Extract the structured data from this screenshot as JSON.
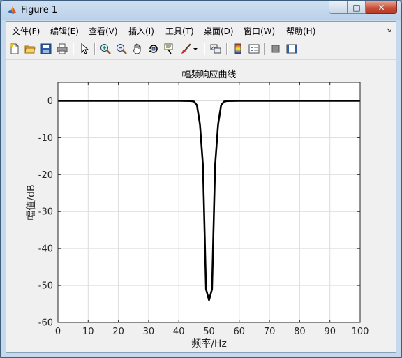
{
  "window": {
    "title": "Figure 1",
    "minimize_glyph": "–",
    "maximize_glyph": "□",
    "close_glyph": "✕"
  },
  "menu": [
    {
      "label": "文件(F)"
    },
    {
      "label": "编辑(E)"
    },
    {
      "label": "查看(V)"
    },
    {
      "label": "插入(I)"
    },
    {
      "label": "工具(T)"
    },
    {
      "label": "桌面(D)"
    },
    {
      "label": "窗口(W)"
    },
    {
      "label": "帮助(H)"
    }
  ],
  "menu_dock_glyph": "↘",
  "toolbar": [
    {
      "icon": "new-figure-icon"
    },
    {
      "icon": "open-file-icon"
    },
    {
      "icon": "save-icon"
    },
    {
      "icon": "print-icon"
    },
    {
      "icon": "pointer-icon"
    },
    {
      "icon": "zoom-in-icon"
    },
    {
      "icon": "zoom-out-icon"
    },
    {
      "icon": "pan-icon"
    },
    {
      "icon": "rotate-3d-icon"
    },
    {
      "icon": "data-cursor-icon"
    },
    {
      "icon": "brush-icon"
    },
    {
      "icon": "link-plot-icon"
    },
    {
      "icon": "colorbar-icon"
    },
    {
      "icon": "legend-icon"
    },
    {
      "icon": "hide-plot-tools-icon"
    },
    {
      "icon": "show-plot-tools-icon"
    }
  ],
  "colors": {
    "line": "#000000",
    "grid": "#dcdcdc",
    "axes_bg": "#ffffff",
    "figure_bg": "#f0f0f0"
  },
  "chart_data": {
    "type": "line",
    "title": "幅频响应曲线",
    "xlabel": "频率/Hz",
    "ylabel": "幅值/dB",
    "xlim": [
      0,
      100
    ],
    "ylim": [
      -60,
      5
    ],
    "xticks": [
      0,
      10,
      20,
      30,
      40,
      50,
      60,
      70,
      80,
      90,
      100
    ],
    "yticks": [
      0,
      -10,
      -20,
      -30,
      -40,
      -50,
      -60
    ],
    "grid": true,
    "series": [
      {
        "x": [
          0,
          10,
          20,
          30,
          40,
          44,
          45,
          46,
          47,
          48,
          49,
          50,
          51,
          52,
          53,
          54,
          55,
          56,
          60,
          70,
          80,
          90,
          100
        ],
        "y": [
          0,
          0,
          0,
          0,
          0,
          -0.05,
          -0.2,
          -1.2,
          -6.4,
          -17.5,
          -51,
          -54,
          -51,
          -17.5,
          -6.4,
          -1.2,
          -0.2,
          -0.05,
          0,
          0,
          0,
          0,
          0
        ]
      }
    ]
  }
}
